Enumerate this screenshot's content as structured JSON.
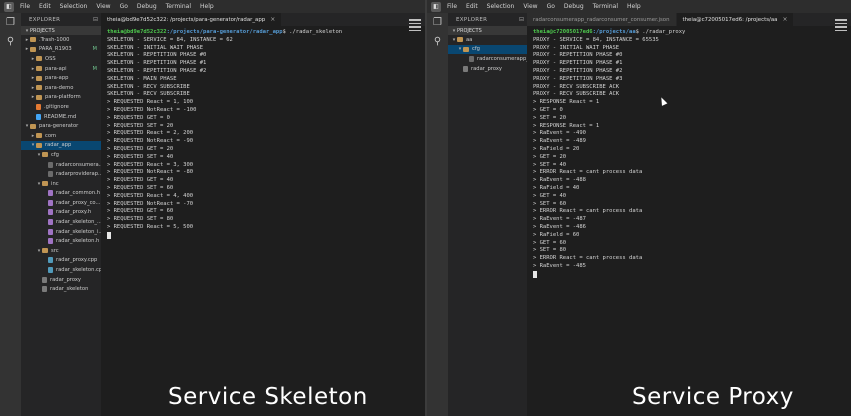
{
  "menu": [
    "File",
    "Edit",
    "Selection",
    "View",
    "Go",
    "Debug",
    "Terminal",
    "Help"
  ],
  "left": {
    "explorer_title": "EXPLORER",
    "section": "PROJECTS",
    "tree": [
      {
        "depth": 0,
        "twisty": "▸",
        "type": "folder",
        "label": ".Trash-1000"
      },
      {
        "depth": 0,
        "twisty": "▸",
        "type": "folder",
        "label": "PARA_R1903",
        "flag": "M"
      },
      {
        "depth": 1,
        "twisty": "▸",
        "type": "folder",
        "label": "OSS"
      },
      {
        "depth": 1,
        "twisty": "▸",
        "type": "folder",
        "label": "para-api",
        "flag": "M"
      },
      {
        "depth": 1,
        "twisty": "▸",
        "type": "folder",
        "label": "para-app"
      },
      {
        "depth": 1,
        "twisty": "▸",
        "type": "folder",
        "label": "para-demo"
      },
      {
        "depth": 1,
        "twisty": "▸",
        "type": "folder",
        "label": "para-platform"
      },
      {
        "depth": 1,
        "twisty": "",
        "type": "git",
        "label": ".gitignore"
      },
      {
        "depth": 1,
        "twisty": "",
        "type": "md",
        "label": "README.md"
      },
      {
        "depth": 0,
        "twisty": "▾",
        "type": "folder",
        "label": "para-generator"
      },
      {
        "depth": 1,
        "twisty": "▸",
        "type": "folder",
        "label": "com"
      },
      {
        "depth": 1,
        "twisty": "▾",
        "type": "folder",
        "label": "radar_app",
        "selected": true
      },
      {
        "depth": 2,
        "twisty": "▾",
        "type": "folder",
        "label": "cfg"
      },
      {
        "depth": 3,
        "twisty": "",
        "type": "file",
        "label": "radarconsumera..."
      },
      {
        "depth": 3,
        "twisty": "",
        "type": "file",
        "label": "radarproviderap..."
      },
      {
        "depth": 2,
        "twisty": "▾",
        "type": "folder",
        "label": "inc"
      },
      {
        "depth": 3,
        "twisty": "",
        "type": "h",
        "label": "radar_common.h"
      },
      {
        "depth": 3,
        "twisty": "",
        "type": "h",
        "label": "radar_proxy_co..."
      },
      {
        "depth": 3,
        "twisty": "",
        "type": "h",
        "label": "radar_proxy.h"
      },
      {
        "depth": 3,
        "twisty": "",
        "type": "h",
        "label": "radar_skeleton_..."
      },
      {
        "depth": 3,
        "twisty": "",
        "type": "h",
        "label": "radar_skeleton_i..."
      },
      {
        "depth": 3,
        "twisty": "",
        "type": "h",
        "label": "radar_skeleton.h"
      },
      {
        "depth": 2,
        "twisty": "▾",
        "type": "folder",
        "label": "src"
      },
      {
        "depth": 3,
        "twisty": "",
        "type": "cpp",
        "label": "radar_proxy.cpp"
      },
      {
        "depth": 3,
        "twisty": "",
        "type": "cpp",
        "label": "radar_skeleton.cpp"
      },
      {
        "depth": 2,
        "twisty": "",
        "type": "bin",
        "label": "radar_proxy"
      },
      {
        "depth": 2,
        "twisty": "",
        "type": "bin",
        "label": "radar_skeleton"
      }
    ],
    "tab": "theia@bd9e7d52c322: /projects/para-generator/radar_app",
    "prompt_user": "theia@bd9e7d52c322",
    "prompt_path": ":/projects/para-generator/radar_app",
    "prompt_cmd": "$ ./radar_skeleton",
    "lines": [
      "SKELETON - SERVICE = 84, INSTANCE = 62",
      "SKELETON - INITIAL WAIT PHASE",
      "SKELETON - REPETITION PHASE #0",
      "SKELETON - REPETITION PHASE #1",
      "SKELETON - REPETITION PHASE #2",
      "SKELETON - MAIN PHASE",
      "SKELETON - RECV SUBSCRIBE",
      "SKELETON - RECV SUBSCRIBE",
      "> REQUESTED React = 1, 100",
      "> REQUESTED NotReact = -100",
      "> REQUESTED GET = 0",
      "> REQUESTED SET = 20",
      "> REQUESTED React = 2, 200",
      "> REQUESTED NotReact = -90",
      "> REQUESTED GET = 20",
      "> REQUESTED SET = 40",
      "> REQUESTED React = 3, 300",
      "> REQUESTED NotReact = -80",
      "> REQUESTED GET = 40",
      "> REQUESTED SET = 60",
      "> REQUESTED React = 4, 400",
      "> REQUESTED NotReact = -70",
      "> REQUESTED GET = 60",
      "> REQUESTED SET = 80",
      "> REQUESTED React = 5, 500"
    ],
    "caption": "Service Skeleton"
  },
  "right": {
    "explorer_title": "EXPLORER",
    "section": "PROJECTS",
    "tree": [
      {
        "depth": 0,
        "twisty": "▾",
        "type": "folder",
        "label": "aa"
      },
      {
        "depth": 1,
        "twisty": "▾",
        "type": "folder",
        "label": "cfg",
        "selected": true
      },
      {
        "depth": 2,
        "twisty": "",
        "type": "file",
        "label": "radarconsumerapp_rad..."
      },
      {
        "depth": 1,
        "twisty": "",
        "type": "bin",
        "label": "radar_proxy"
      }
    ],
    "tabs": [
      {
        "label": "radarconsumerapp_radarconsumer_consumer.json",
        "active": false
      },
      {
        "label": "theia@c72005017ed6: /projects/aa",
        "active": true
      }
    ],
    "prompt_user": "theia@c72005017ed6",
    "prompt_path": ":/projects/aa",
    "prompt_cmd": "$ ./radar_proxy",
    "lines": [
      "PROXY - SERVICE = 84, INSTANCE = 65535",
      "PROXY - INITIAL WAIT PHASE",
      "PROXY - REPETITION PHASE #0",
      "PROXY - REPETITION PHASE #1",
      "PROXY - REPETITION PHASE #2",
      "PROXY - REPETITION PHASE #3",
      "PROXY - RECV SUBSCRIBE ACK",
      "PROXY - RECV SUBSCRIBE ACK",
      "> RESPONSE React = 1",
      "> GET = 0",
      "> SET = 20",
      "> RESPONSE React = 1",
      "> RaEvent = -490",
      "> RaEvent = -489",
      "> RaField = 20",
      "> GET = 20",
      "> SET = 40",
      "> ERROR React = cant process data",
      "> RaEvent = -488",
      "> RaField = 40",
      "> GET = 40",
      "> SET = 60",
      "> ERROR React = cant process data",
      "> RaEvent = -487",
      "> RaEvent = -486",
      "> RaField = 60",
      "> GET = 60",
      "> SET = 80",
      "> ERROR React = cant process data",
      "> RaEvent = -485"
    ],
    "caption": "Service Proxy"
  },
  "icons": {
    "logo": "theia-logo-icon",
    "files": "files-icon",
    "search": "search-icon",
    "menu": "hamburger-menu-icon"
  }
}
